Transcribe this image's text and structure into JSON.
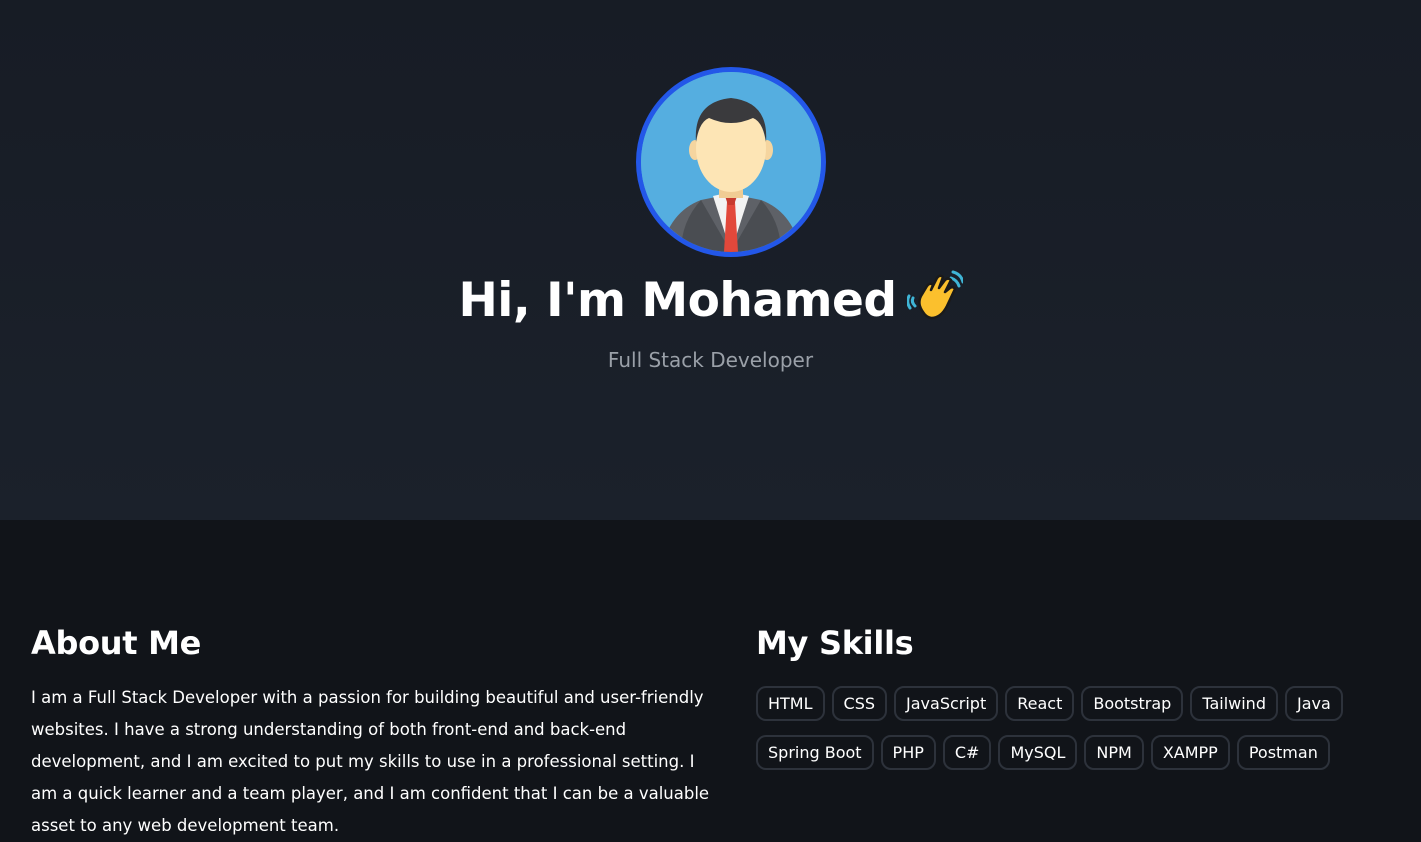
{
  "hero": {
    "greeting": "Hi, I'm Mohamed",
    "wave_emoji": "waving-hand",
    "subtitle": "Full Stack Developer",
    "avatar_icon": "businessman-avatar",
    "avatar_border_color": "#2357e8"
  },
  "about": {
    "title": "About Me",
    "text": "I am a Full Stack Developer with a passion for building beautiful and user-friendly websites. I have a strong understanding of both front-end and back-end development, and I am excited to put my skills to use in a professional setting. I am a quick learner and a team player, and I am confident that I can be a valuable asset to any web development team."
  },
  "skills": {
    "title": "My Skills",
    "items": [
      "HTML",
      "CSS",
      "JavaScript",
      "React",
      "Bootstrap",
      "Tailwind",
      "Java",
      "Spring Boot",
      "PHP",
      "C#",
      "MySQL",
      "NPM",
      "XAMPP",
      "Postman"
    ]
  },
  "colors": {
    "hero_bg": "#1b212b",
    "page_bg": "#111419",
    "chip_border": "#2d323b",
    "subtitle": "#9aa0a8"
  }
}
